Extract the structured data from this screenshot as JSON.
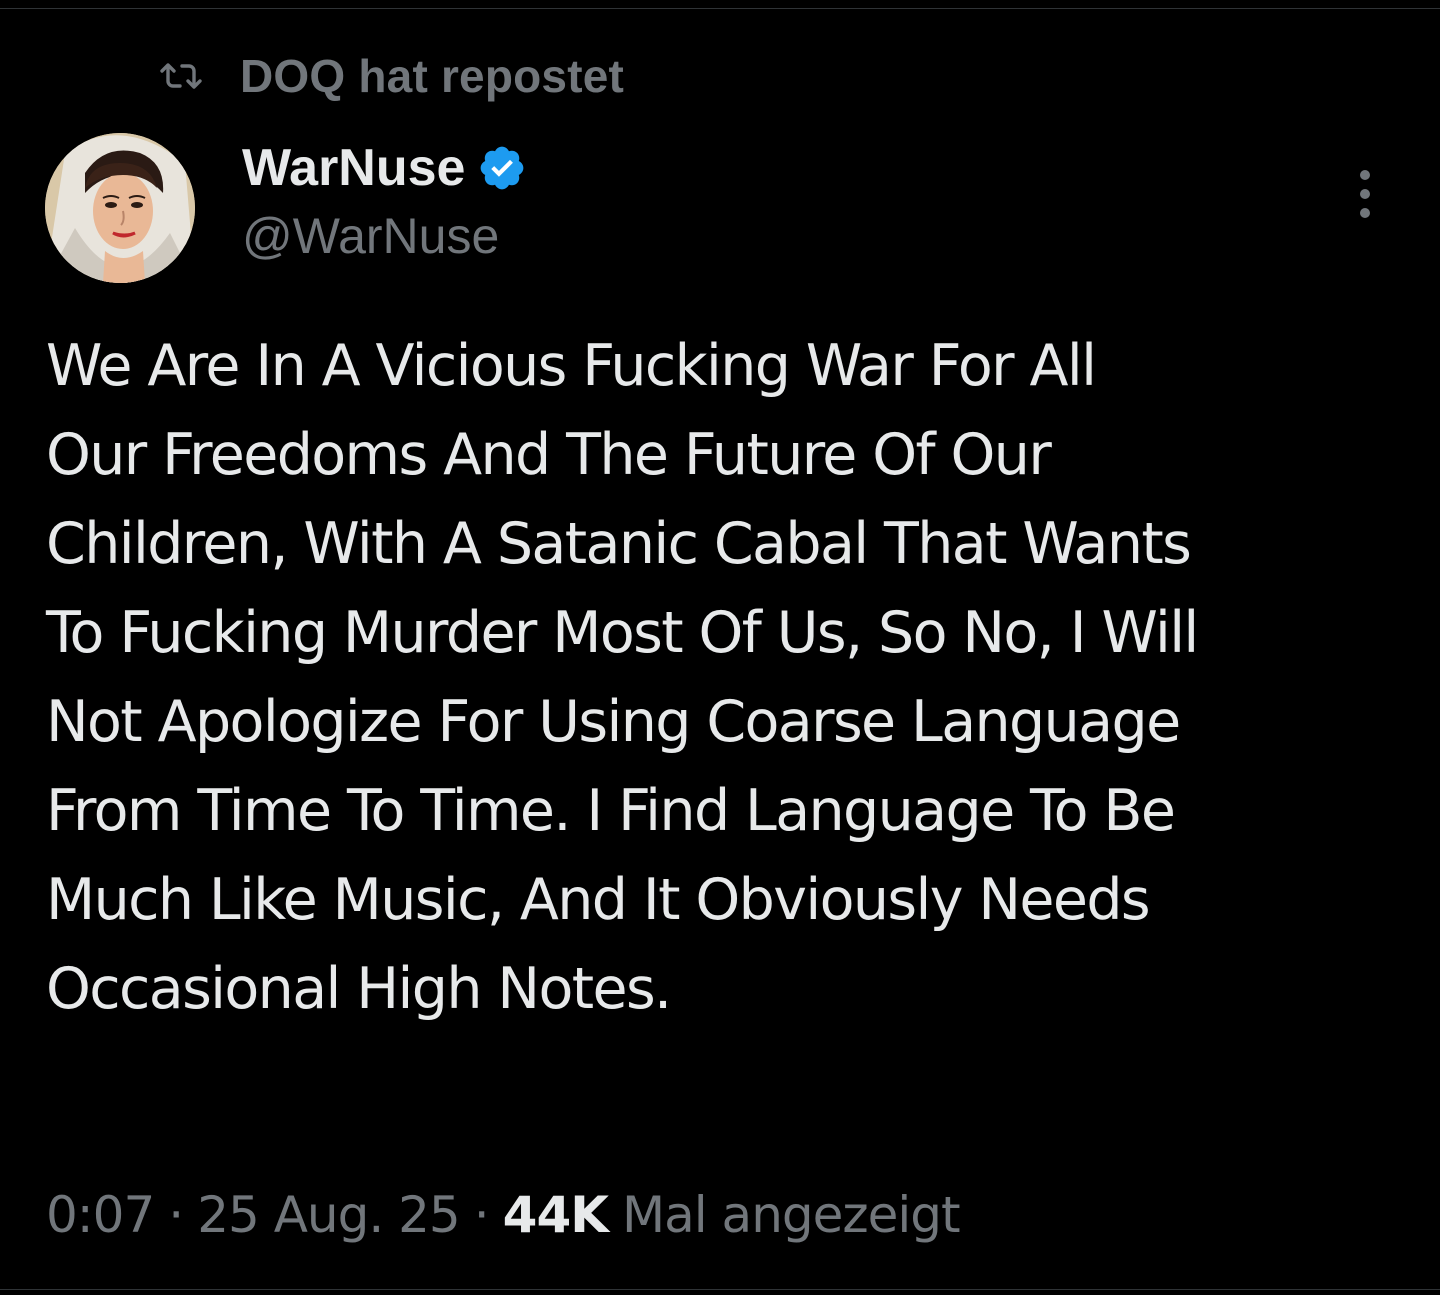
{
  "repost": {
    "icon": "repost-icon",
    "text": "DOQ hat repostet"
  },
  "author": {
    "display_name": "WarNuse",
    "handle": "@WarNuse",
    "verified": true,
    "verified_icon": "verified-badge-icon",
    "avatar_icon": "avatar"
  },
  "more_icon": "more-vertical-icon",
  "tweet": {
    "lines": [
      "We Are In A Vicious Fucking War For All",
      "Our Freedoms And The Future Of Our",
      "Children, With A Satanic Cabal That Wants",
      "To Fucking Murder Most Of Us, So No, I Will",
      "Not Apologize For Using Coarse Language",
      "From Time To Time. I Find Language To Be",
      "Much Like Music, And It Obviously Needs",
      "Occasional High Notes."
    ]
  },
  "meta": {
    "time": "0:07",
    "separator": "·",
    "date": "25 Aug. 25",
    "views_count": "44K",
    "views_label": "Mal angezeigt"
  },
  "colors": {
    "background": "#000000",
    "text_primary": "#e7e9ea",
    "text_secondary": "#71767b",
    "verified_blue": "#1d9bf0",
    "divider": "#2f3336"
  }
}
